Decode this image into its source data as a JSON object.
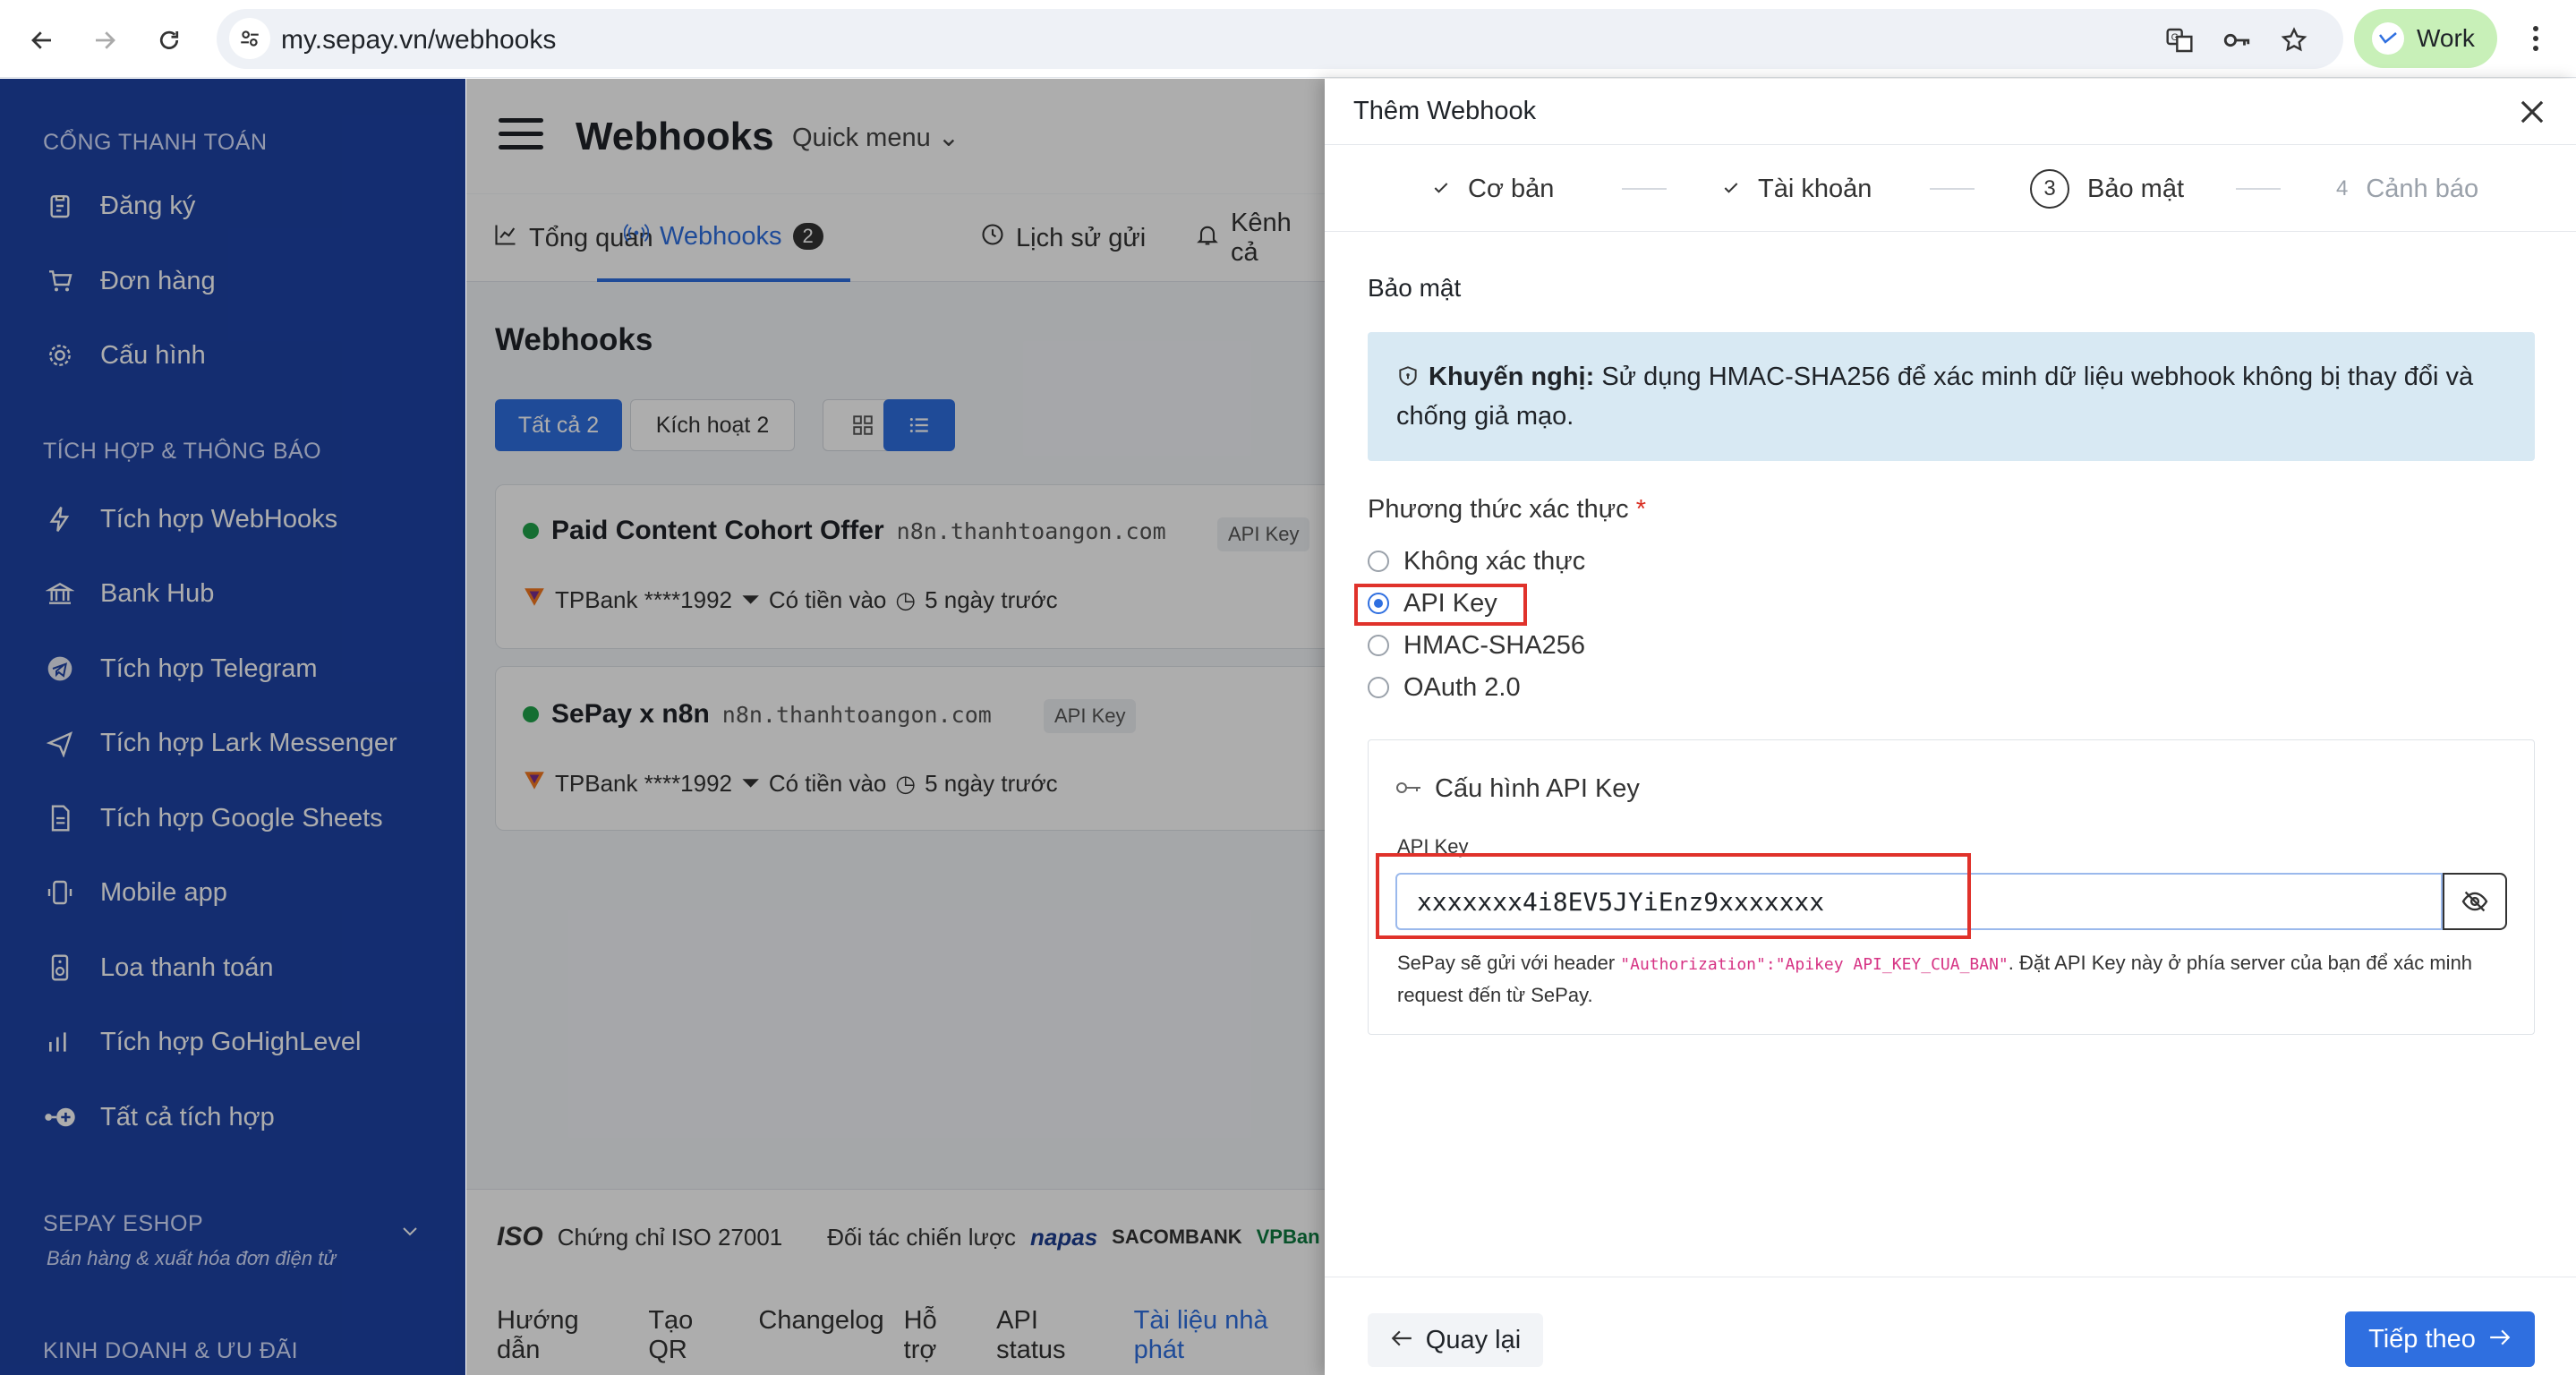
{
  "browser": {
    "url": "my.sepay.vn/webhooks",
    "profile_label": "Work"
  },
  "sidebar": {
    "sections": {
      "payment_gateway": "CỔNG THANH TOÁN",
      "integrations": "TÍCH HỢP & THÔNG BÁO",
      "eshop": "SEPAY ESHOP",
      "eshop_sub": "Bán hàng & xuất hóa đơn điện tử",
      "business": "KINH DOANH & ƯU ĐÃI"
    },
    "items": [
      {
        "label": "Đăng ký",
        "icon": "clipboard-icon"
      },
      {
        "label": "Đơn hàng",
        "icon": "cart-icon"
      },
      {
        "label": "Cấu hình",
        "icon": "gear-icon"
      },
      {
        "label": "Tích hợp WebHooks",
        "icon": "bolt-icon"
      },
      {
        "label": "Bank Hub",
        "icon": "bank-icon"
      },
      {
        "label": "Tích hợp Telegram",
        "icon": "telegram-icon"
      },
      {
        "label": "Tích hợp Lark Messenger",
        "icon": "send-icon"
      },
      {
        "label": "Tích hợp Google Sheets",
        "icon": "sheet-icon"
      },
      {
        "label": "Mobile app",
        "icon": "mobile-icon"
      },
      {
        "label": "Loa thanh toán",
        "icon": "speaker-icon"
      },
      {
        "label": "Tích hợp GoHighLevel",
        "icon": "chart-icon"
      },
      {
        "label": "Tất cả tích hợp",
        "icon": "plus-circle-icon"
      }
    ]
  },
  "main": {
    "title": "Webhooks",
    "quick_menu": "Quick menu",
    "tabs": [
      {
        "label": "Tổng quan"
      },
      {
        "label": "Webhooks",
        "badge": "2"
      },
      {
        "label": "Lịch sử gửi"
      },
      {
        "label": "Kênh cả"
      }
    ],
    "section_title": "Webhooks",
    "filters": {
      "all": "Tất cả 2",
      "active": "Kích hoạt 2"
    },
    "cards": [
      {
        "name": "Paid Content Cohort Offer",
        "host": "n8n.thanhtoangon.com",
        "chip": "API Key",
        "bank": "TPBank ****1992",
        "event": "Có tiền vào",
        "time": "5 ngày trước"
      },
      {
        "name": "SePay x n8n",
        "host": "n8n.thanhtoangon.com",
        "chip": "API Key",
        "bank": "TPBank ****1992",
        "event": "Có tiền vào",
        "time": "5 ngày trước"
      }
    ],
    "footer": {
      "iso": "Chứng chỉ ISO 27001",
      "partners": "Đối tác chiến lược",
      "partner_logos": [
        "napas",
        "SACOMBANK",
        "VPBan"
      ],
      "links": [
        "Hướng dẫn",
        "Tạo QR",
        "Changelog",
        "Hỗ trợ",
        "API status",
        "Tài liệu nhà phát"
      ]
    }
  },
  "panel": {
    "title": "Thêm Webhook",
    "steps": [
      {
        "label": "Cơ bản",
        "state": "done"
      },
      {
        "label": "Tài khoản",
        "state": "done"
      },
      {
        "num": "3",
        "label": "Bảo mật",
        "state": "current"
      },
      {
        "num": "4",
        "label": "Cảnh báo",
        "state": "todo"
      }
    ],
    "section_title": "Bảo mật",
    "alert": {
      "bold": "Khuyến nghị:",
      "text": " Sử dụng HMAC-SHA256 để xác minh dữ liệu webhook không bị thay đổi và chống giả mạo."
    },
    "auth_label": "Phương thức xác thực",
    "required_mark": "*",
    "auth_options": [
      "Không xác thực",
      "API Key",
      "HMAC-SHA256",
      "OAuth 2.0"
    ],
    "auth_selected": "API Key",
    "config_title": "Cấu hình API Key",
    "api_key_label": "API Key",
    "api_key_value": "xxxxxxx4i8EV5JYiEnz9xxxxxxx",
    "help_prefix": "SePay sẽ gửi với header ",
    "help_code": "\"Authorization\":\"Apikey API_KEY_CUA_BAN\"",
    "help_suffix": ". Đặt API Key này ở phía server của bạn để xác minh request đến từ SePay.",
    "back_label": "Quay lại",
    "next_label": "Tiếp theo",
    "colors": {
      "accent": "#2f6fe0",
      "highlight": "#e0322b",
      "alert_bg": "#d8e9f3",
      "sidebar_bg": "#1e43a6"
    }
  }
}
